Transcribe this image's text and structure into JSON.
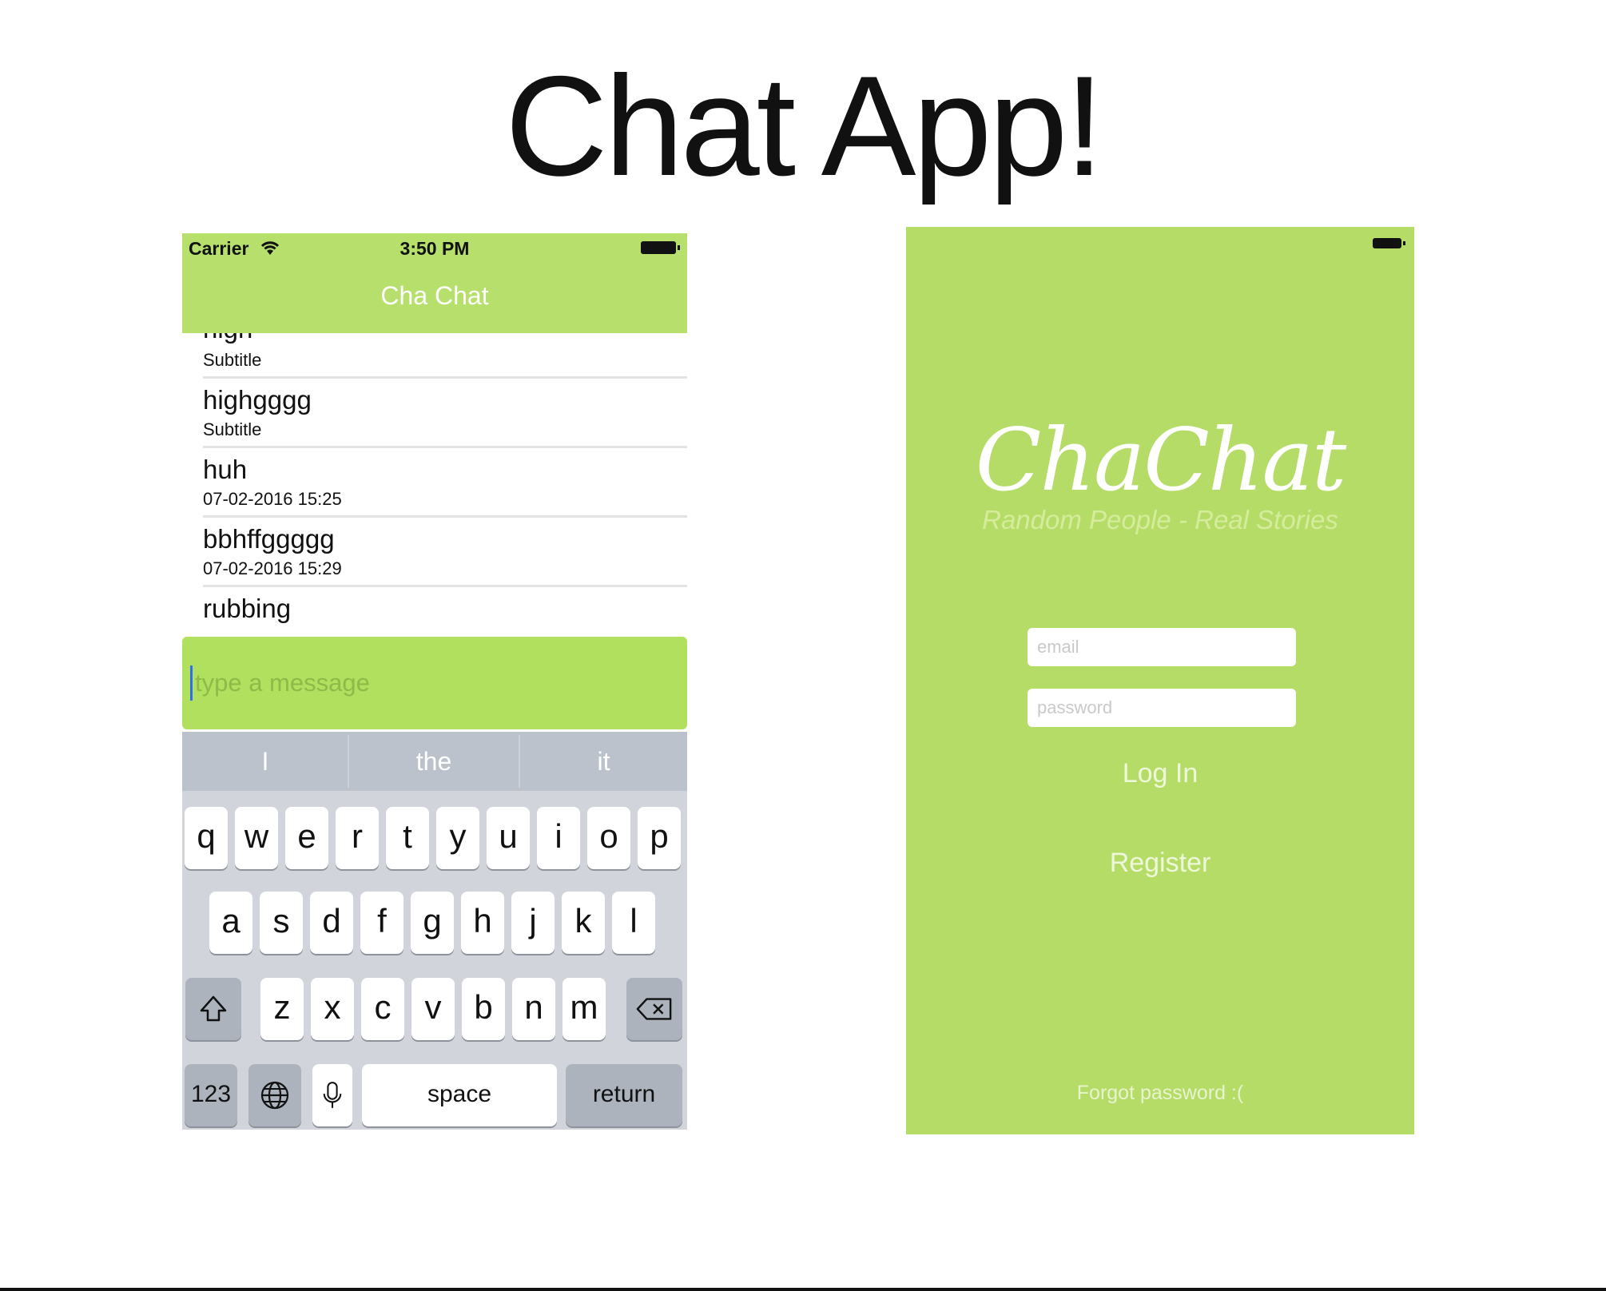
{
  "slide": {
    "title": "Chat App!"
  },
  "chat_screen": {
    "status_bar": {
      "carrier": "Carrier",
      "time": "3:50 PM"
    },
    "nav_title": "Cha Chat",
    "rows": [
      {
        "title": "high",
        "subtitle": "Subtitle"
      },
      {
        "title": "highgggg",
        "subtitle": "Subtitle"
      },
      {
        "title": "huh",
        "subtitle": "07-02-2016 15:25"
      },
      {
        "title": "bbhffggggg",
        "subtitle": "07-02-2016 15:29"
      },
      {
        "title": "rubbing",
        "subtitle": ""
      }
    ],
    "composer": {
      "placeholder": "type a message",
      "value": ""
    },
    "keyboard": {
      "predictions": [
        "I",
        "the",
        "it"
      ],
      "row1": [
        "q",
        "w",
        "e",
        "r",
        "t",
        "y",
        "u",
        "i",
        "o",
        "p"
      ],
      "row2": [
        "a",
        "s",
        "d",
        "f",
        "g",
        "h",
        "j",
        "k",
        "l"
      ],
      "row3": [
        "z",
        "x",
        "c",
        "v",
        "b",
        "n",
        "m"
      ],
      "numbers_label": "123",
      "space_label": "space",
      "return_label": "return"
    }
  },
  "login_screen": {
    "logo": "ChaChat",
    "tagline": "Random People - Real Stories",
    "email_placeholder": "email",
    "password_placeholder": "password",
    "login_label": "Log In",
    "register_label": "Register",
    "forgot_label": "Forgot password :("
  },
  "colors": {
    "nav_green": "#b6df6c",
    "composer_green": "#b1df5e",
    "login_green": "#b5dc67",
    "keyboard_gray": "#d1d4da"
  },
  "icons": [
    "wifi-icon",
    "battery-icon",
    "shift-icon",
    "backspace-icon",
    "globe-icon",
    "microphone-icon"
  ]
}
